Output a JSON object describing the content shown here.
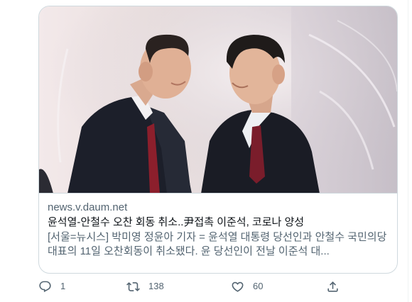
{
  "card": {
    "domain": "news.v.daum.net",
    "title": "윤석열-안철수 오찬 회동 취소..尹접촉 이준석, 코로나 양성",
    "description": "[서울=뉴시스] 박미영 정윤아 기자 = 윤석열 대통령 당선인과 안철수 국민의당 대표의 11일 오찬회동이 취소됐다. 윤 당선인이 전날 이준석 대...",
    "image": {
      "subject": "two-men-in-suits-greeting",
      "accent": "#f3e9ea"
    }
  },
  "actions": {
    "reply": {
      "icon": "reply-icon",
      "count": "1"
    },
    "retweet": {
      "icon": "retweet-icon",
      "count": "138"
    },
    "like": {
      "icon": "heart-icon",
      "count": "60"
    },
    "share": {
      "icon": "share-icon"
    }
  },
  "colors": {
    "text_primary": "#0f1419",
    "text_secondary": "#536471",
    "border": "#cfd9de"
  }
}
